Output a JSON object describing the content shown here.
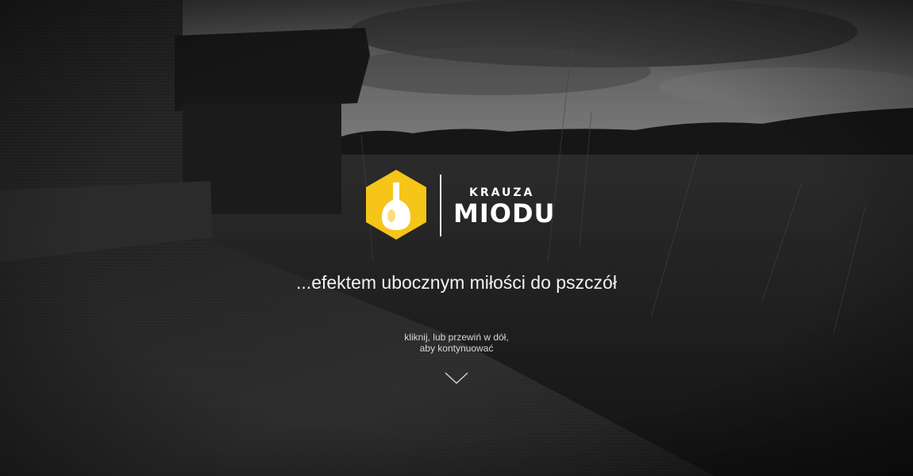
{
  "logo": {
    "small_text": "KRAUZA",
    "big_text": "MIODU",
    "icon": "honey-drop-hexagon-icon",
    "accent_color": "#F5C518"
  },
  "tagline": "...efektem ubocznym miłości do pszczół",
  "scroll_hint": {
    "line1": "kliknij, lub przewiń w dół,",
    "line2": "aby kontynuować",
    "icon": "chevron-down-icon"
  }
}
